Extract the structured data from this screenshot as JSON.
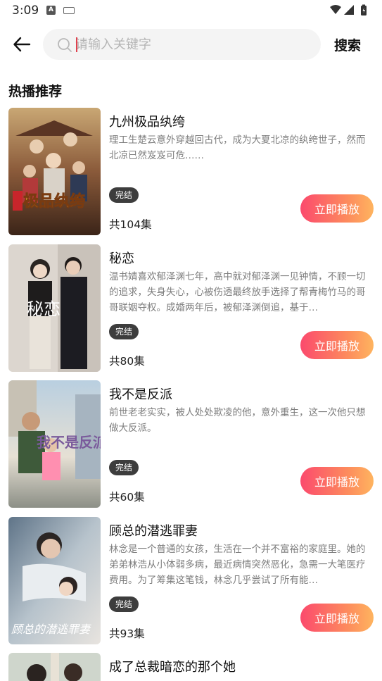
{
  "status_bar": {
    "time": "3:09"
  },
  "header": {
    "search_placeholder": "请输入关键字",
    "search_button": "搜索"
  },
  "section": {
    "title": "热播推荐"
  },
  "items": [
    {
      "title": "九州极品纨绔",
      "description": "理工生楚云意外穿越回古代，成为大夏北凉的纨绔世子，然而北凉已然岌岌可危……",
      "status": "完结",
      "episodes": "共104集",
      "button": "立即播放",
      "poster_text": "极品纨绔"
    },
    {
      "title": "秘恋",
      "description": "温书婧喜欢郁泽渊七年，高中就对郁泽渊一见钟情，不顾一切的追求，失身失心，心被伤透最终放手选择了帮青梅竹马的哥哥联姻夺权。成婚两年后，被郁泽渊倒追，基于…",
      "status": "完结",
      "episodes": "共80集",
      "button": "立即播放",
      "poster_text": "秘恋"
    },
    {
      "title": "我不是反派",
      "description": "前世老老实实，被人处处欺凌的他，意外重生，这一次他只想做大反派。",
      "status": "完结",
      "episodes": "共60集",
      "button": "立即播放",
      "poster_text": "我不是反派"
    },
    {
      "title": "顾总的潜逃罪妻",
      "description": "林念是一个普通的女孩，生活在一个并不富裕的家庭里。她的弟弟林浩从小体弱多病，最近病情突然恶化，急需一大笔医疗费用。为了筹集这笔钱，林念几乎尝试了所有能…",
      "status": "完结",
      "episodes": "共93集",
      "button": "立即播放",
      "poster_text": "顾总的潜逃罪妻"
    },
    {
      "title": "成了总裁暗恋的那个她"
    }
  ]
}
